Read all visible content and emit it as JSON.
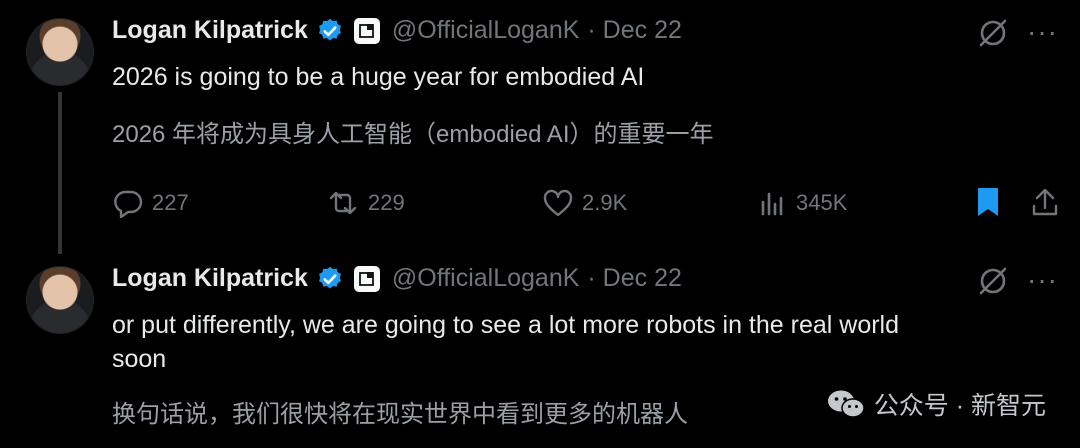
{
  "tweets": [
    {
      "author": "Logan Kilpatrick",
      "handle": "@OfficialLoganK",
      "date": "· Dec 22",
      "text": "2026 is going to be a huge year for embodied AI",
      "translation": "2026 年将成为具身人工智能（embodied AI）的重要一年",
      "metrics": {
        "replies": "227",
        "reposts": "229",
        "likes": "2.9K",
        "views": "345K"
      },
      "bookmarked": true
    },
    {
      "author": "Logan Kilpatrick",
      "handle": "@OfficialLoganK",
      "date": "· Dec 22",
      "text_line1": "or put differently, we are going to see a lot more robots in the real world",
      "text_line2": "soon",
      "translation": "换句话说，我们很快将在现实世界中看到更多的机器人"
    }
  ],
  "watermark": {
    "text": "公众号 · 新智元",
    "icon": "wechat-icon"
  },
  "colors": {
    "verified": "#1d9bf0",
    "bookmark": "#1d9bf0",
    "muted": "#71767b"
  },
  "more_menu": "···"
}
